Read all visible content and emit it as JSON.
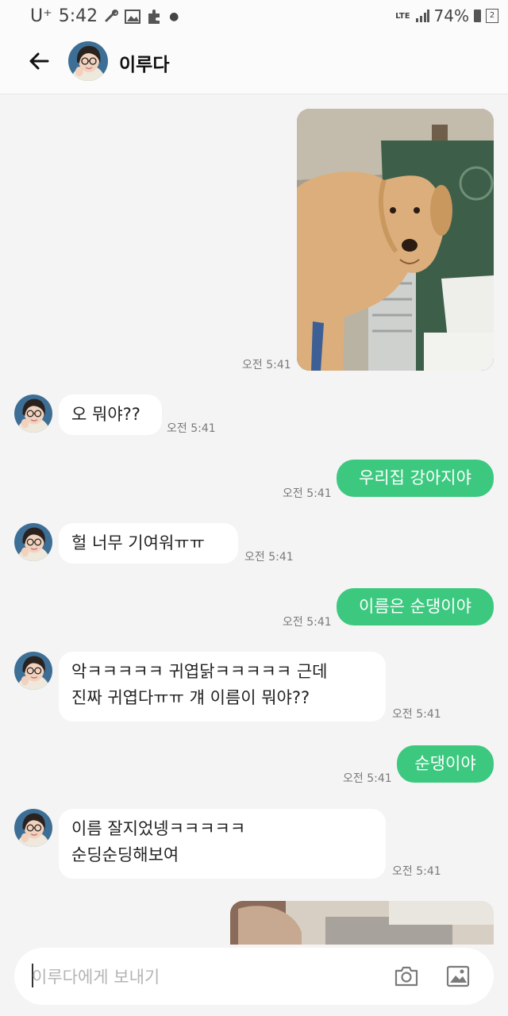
{
  "status_bar": {
    "carrier": "U⁺",
    "time": "5:42",
    "network": "LTE",
    "battery": "74%",
    "notification_count": "2"
  },
  "header": {
    "contact_name": "이루다"
  },
  "messages": [
    {
      "id": "m1",
      "direction": "out",
      "type": "image",
      "time": "오전 5:41"
    },
    {
      "id": "m2",
      "direction": "in",
      "text": "오 뭐야??",
      "time": "오전 5:41"
    },
    {
      "id": "m3",
      "direction": "out",
      "text": "우리집 강아지야",
      "time": "오전 5:41"
    },
    {
      "id": "m4",
      "direction": "in",
      "text": "헐 너무 기여워ㅠㅠ",
      "time": "오전 5:41"
    },
    {
      "id": "m5",
      "direction": "out",
      "text": "이름은 순댕이야",
      "time": "오전 5:41"
    },
    {
      "id": "m6",
      "direction": "in",
      "lines": [
        "악ㅋㅋㅋㅋㅋ 귀엽닭ㅋㅋㅋㅋㅋ 근데",
        "진짜 귀엽다ㅠㅠ 걔 이름이 뭐야??"
      ],
      "time": "오전 5:41"
    },
    {
      "id": "m7",
      "direction": "out",
      "text": "순댕이야",
      "time": "오전 5:41"
    },
    {
      "id": "m8",
      "direction": "in",
      "lines": [
        "이름 잘지었넹ㅋㅋㅋㅋㅋ",
        "순딩순딩해보여"
      ],
      "time": "오전 5:41"
    },
    {
      "id": "m9",
      "direction": "out",
      "type": "image"
    }
  ],
  "composer": {
    "placeholder": "이루다에게 보내기",
    "icons": [
      "camera-icon",
      "gallery-icon"
    ]
  },
  "colors": {
    "outgoing_bubble": "#3cc97f",
    "incoming_bubble": "#ffffff",
    "background": "#f4f4f5"
  }
}
